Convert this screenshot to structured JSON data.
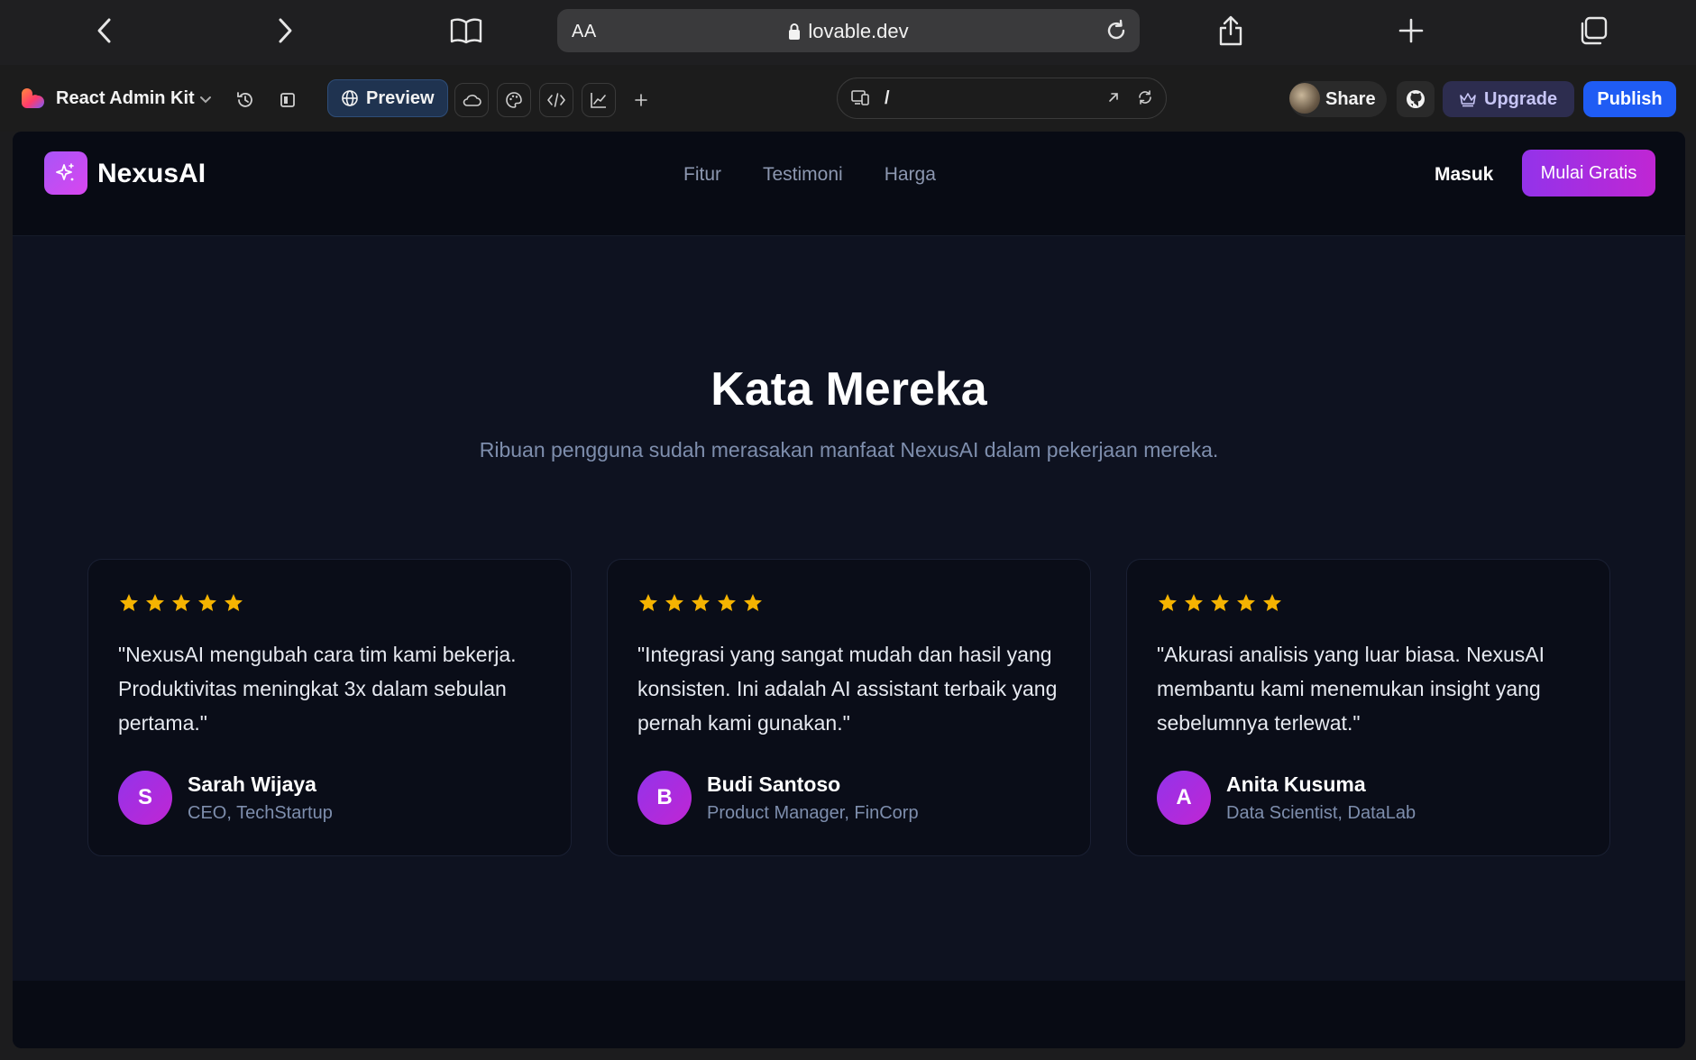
{
  "browser": {
    "text_size_label": "AA",
    "url": "lovable.dev"
  },
  "editor": {
    "project_name": "React Admin Kit",
    "preview_label": "Preview",
    "route_path": "/",
    "share_label": "Share",
    "upgrade_label": "Upgrade",
    "publish_label": "Publish"
  },
  "site": {
    "brand": "NexusAI",
    "nav": [
      "Fitur",
      "Testimoni",
      "Harga"
    ],
    "login_label": "Masuk",
    "cta_label": "Mulai Gratis"
  },
  "testimonials": {
    "heading": "Kata Mereka",
    "subheading": "Ribuan pengguna sudah merasakan manfaat NexusAI dalam pekerjaan mereka.",
    "items": [
      {
        "rating": 5,
        "quote": "\"NexusAI mengubah cara tim kami bekerja. Produktivitas meningkat 3x dalam sebulan pertama.\"",
        "initial": "S",
        "name": "Sarah Wijaya",
        "role": "CEO, TechStartup"
      },
      {
        "rating": 5,
        "quote": "\"Integrasi yang sangat mudah dan hasil yang konsisten. Ini adalah AI assistant terbaik yang pernah kami gunakan.\"",
        "initial": "B",
        "name": "Budi Santoso",
        "role": "Product Manager, FinCorp"
      },
      {
        "rating": 5,
        "quote": "\"Akurasi analisis yang luar biasa. NexusAI membantu kami menemukan insight yang sebelumnya terlewat.\"",
        "initial": "A",
        "name": "Anita Kusuma",
        "role": "Data Scientist, DataLab"
      }
    ]
  },
  "colors": {
    "accent_purple": "#9333ea",
    "accent_magenta": "#c026d3",
    "star_yellow": "#f5b301",
    "publish_blue": "#1f5cf4"
  }
}
